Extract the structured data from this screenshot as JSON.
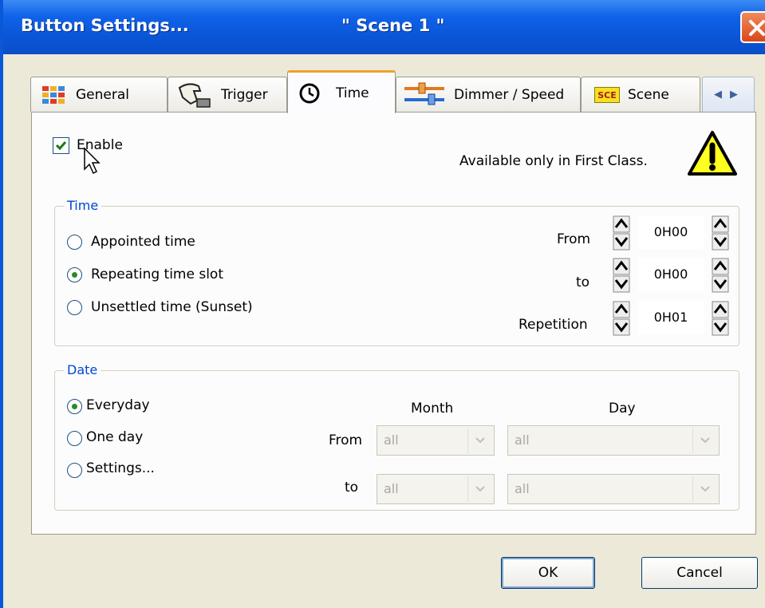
{
  "window": {
    "title": "Button  Settings...",
    "scene": "\" Scene 1 \""
  },
  "tabs": [
    {
      "label": "General",
      "icon": "general-grid-icon"
    },
    {
      "label": "Trigger",
      "icon": "trigger-hand-icon"
    },
    {
      "label": "Time",
      "icon": "clock-icon"
    },
    {
      "label": "Dimmer / Speed",
      "icon": "slider-icon"
    },
    {
      "label": "Scene",
      "icon": "scene-icon",
      "icon_text": "SCE"
    }
  ],
  "enable": {
    "label": "Enable",
    "checked": true
  },
  "availability_note": "Available only in First Class.",
  "time_group": {
    "title": "Time",
    "options": [
      "Appointed time",
      "Repeating time slot",
      "Unsettled time (Sunset)"
    ],
    "selected": 1,
    "fields": [
      {
        "label": "From",
        "value": "0H00"
      },
      {
        "label": "to",
        "value": "0H00"
      },
      {
        "label": "Repetition",
        "value": "0H01"
      }
    ]
  },
  "date_group": {
    "title": "Date",
    "options": [
      "Everyday",
      "One day",
      "Settings..."
    ],
    "selected": 0,
    "month_header": "Month",
    "day_header": "Day",
    "from_label": "From",
    "to_label": "to",
    "from_month": "all",
    "from_day": "all",
    "to_month": "all",
    "to_day": "all"
  },
  "buttons": {
    "ok": "OK",
    "cancel": "Cancel"
  },
  "colors": {
    "titlebar": "#0a55d6",
    "group_title": "#0046d5",
    "active_tab_accent": "#f0a030"
  }
}
